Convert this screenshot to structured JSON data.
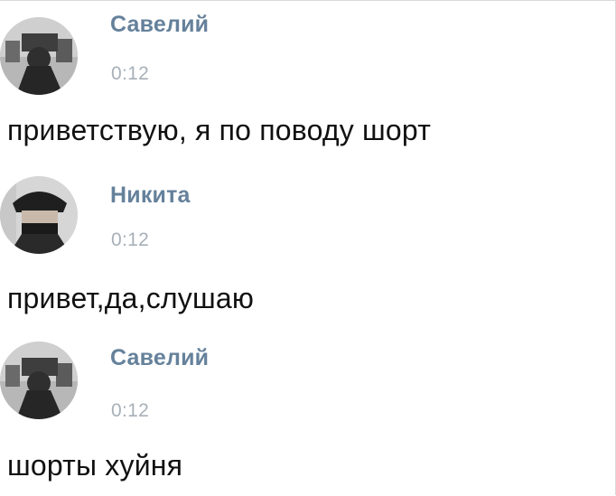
{
  "colors": {
    "author_name": "#65819b",
    "timestamp": "#a8b0b8",
    "message_text": "#111111",
    "background": "#ffffff"
  },
  "messages": [
    {
      "author": "Савелий",
      "time": "0:12",
      "text": "приветствую, я по поводу шорт",
      "avatar_icon": "user-avatar-photo"
    },
    {
      "author": "Никита",
      "time": "0:12",
      "text": "привет,да,слушаю",
      "avatar_icon": "user-avatar-photo"
    },
    {
      "author": "Савелий",
      "time": "0:12",
      "text": "шорты хуйня",
      "avatar_icon": "user-avatar-photo"
    }
  ]
}
